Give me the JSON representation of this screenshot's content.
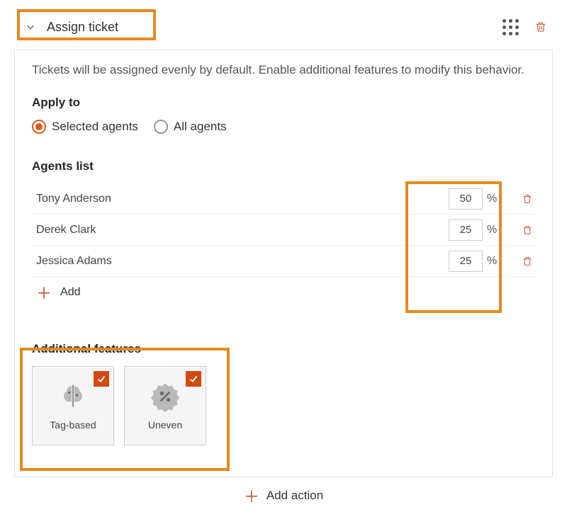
{
  "header": {
    "title": "Assign ticket"
  },
  "description": "Tickets will be assigned evenly by default. Enable additional features to modify this behavior.",
  "apply_to": {
    "title": "Apply to",
    "options": {
      "selected_agents": "Selected agents",
      "all_agents": "All agents"
    },
    "selected": "selected_agents"
  },
  "agents": {
    "title": "Agents list",
    "rows": [
      {
        "name": "Tony Anderson",
        "value": "50",
        "suffix": "%"
      },
      {
        "name": "Derek Clark",
        "value": "25",
        "suffix": "%"
      },
      {
        "name": "Jessica Adams",
        "value": "25",
        "suffix": "%"
      }
    ],
    "add_label": "Add"
  },
  "features": {
    "title": "Additional features",
    "tiles": [
      {
        "key": "tag_based",
        "label": "Tag-based",
        "checked": true
      },
      {
        "key": "uneven",
        "label": "Uneven",
        "checked": true
      }
    ]
  },
  "footer": {
    "add_action_label": "Add action"
  }
}
